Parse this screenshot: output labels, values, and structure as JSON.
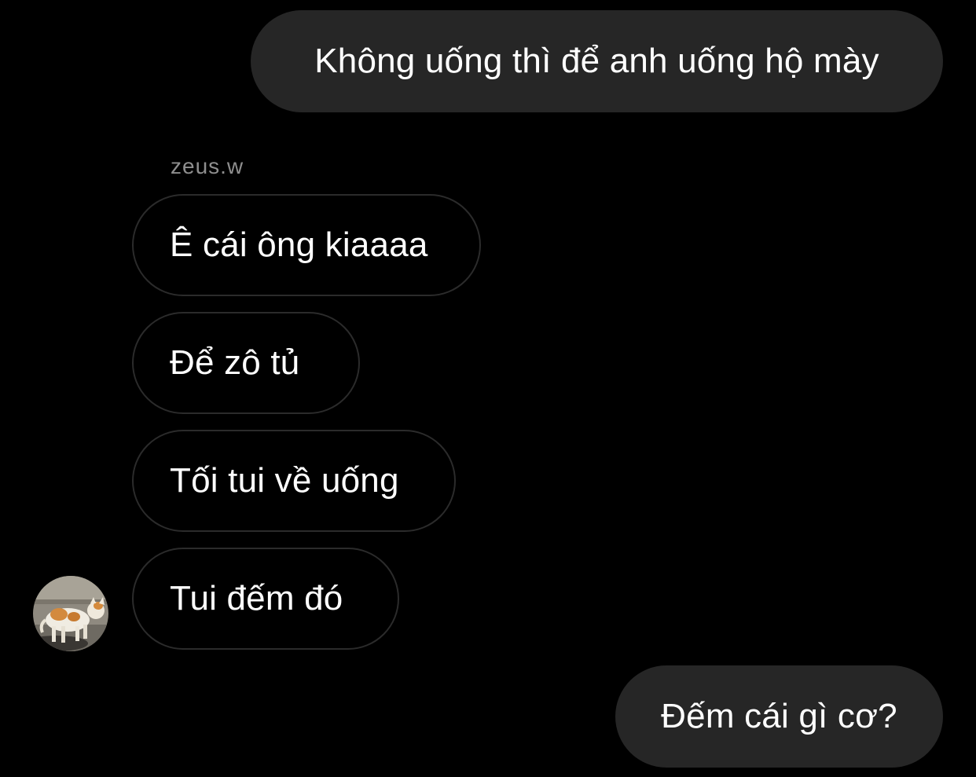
{
  "thread": {
    "sender_name": "zeus.w",
    "messages": [
      {
        "direction": "outgoing",
        "text": "Không uống thì để anh uống hộ mày"
      },
      {
        "direction": "incoming",
        "text": "Ê cái ông kiaaaa"
      },
      {
        "direction": "incoming",
        "text": "Để zô tủ"
      },
      {
        "direction": "incoming",
        "text": "Tối tui về uống"
      },
      {
        "direction": "incoming",
        "text": "Tui đếm đó"
      },
      {
        "direction": "outgoing",
        "text": "Đếm cái gì cơ?"
      }
    ],
    "avatar_icon": "cat-photo-avatar"
  },
  "colors": {
    "background": "#000000",
    "outgoing_bubble": "#262626",
    "incoming_border": "#2b2b2b",
    "sender_name": "#8e8e8e",
    "text": "#ffffff"
  }
}
